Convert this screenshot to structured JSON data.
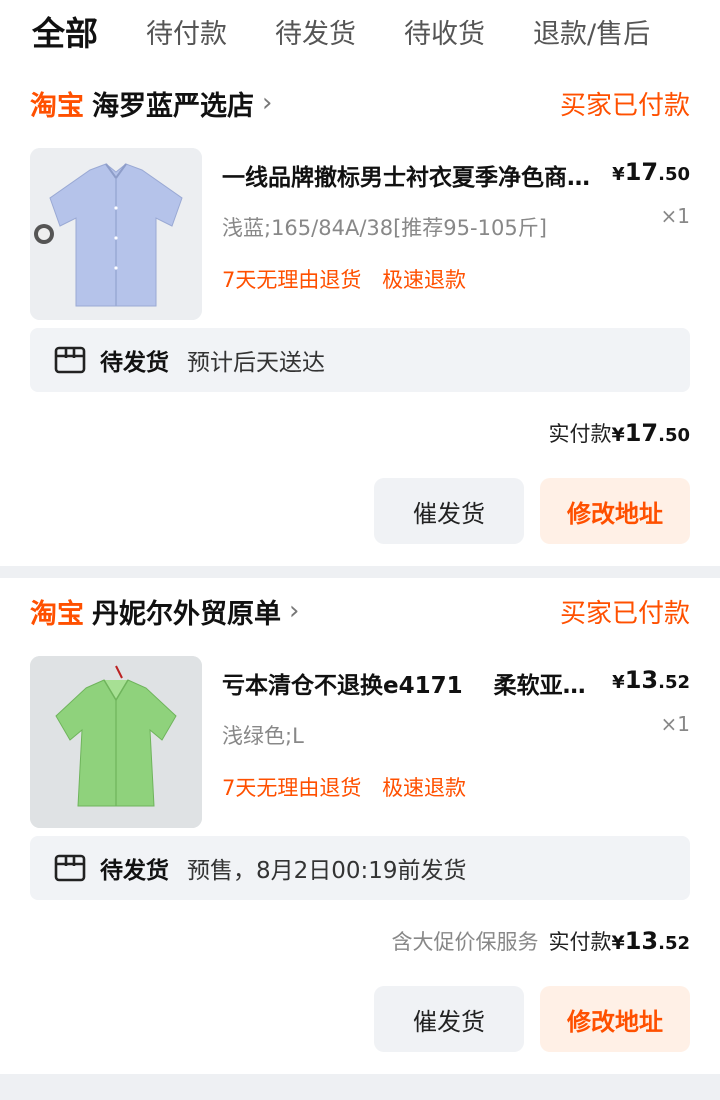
{
  "tabs": [
    "全部",
    "待付款",
    "待发货",
    "待收货",
    "退款/售后"
  ],
  "colors": {
    "accent": "#ff5000"
  },
  "orders": [
    {
      "platform": "淘宝",
      "shop": "海罗蓝严选店",
      "status": "买家已付款",
      "title": "一线品牌撤标男士衬衣夏季净色商…",
      "sku": "浅蓝;165/84A/38[推荐95-105斤]",
      "tag1": "7天无理由退货",
      "tag2": "极速退款",
      "price_yen": "¥",
      "price_int": "17",
      "price_dec": ".50",
      "qty": "×1",
      "ship_label": "待发货",
      "ship_text": "预计后天送达",
      "service": "",
      "total_label": "实付款",
      "total_int": "17",
      "total_dec": ".50",
      "btn1": "催发货",
      "btn2": "修改地址",
      "image": "blue-shirt"
    },
    {
      "platform": "淘宝",
      "shop": "丹妮尔外贸原单",
      "status": "买家已付款",
      "title": "亏本清仓不退换e4171　 柔软亚…",
      "sku": "浅绿色;L",
      "tag1": "7天无理由退货",
      "tag2": "极速退款",
      "price_yen": "¥",
      "price_int": "13",
      "price_dec": ".52",
      "qty": "×1",
      "ship_label": "待发货",
      "ship_text": "预售，8月2日00:19前发货",
      "service": "含大促价保服务",
      "total_label": "实付款",
      "total_int": "13",
      "total_dec": ".52",
      "btn1": "催发货",
      "btn2": "修改地址",
      "image": "green-blouse"
    }
  ]
}
